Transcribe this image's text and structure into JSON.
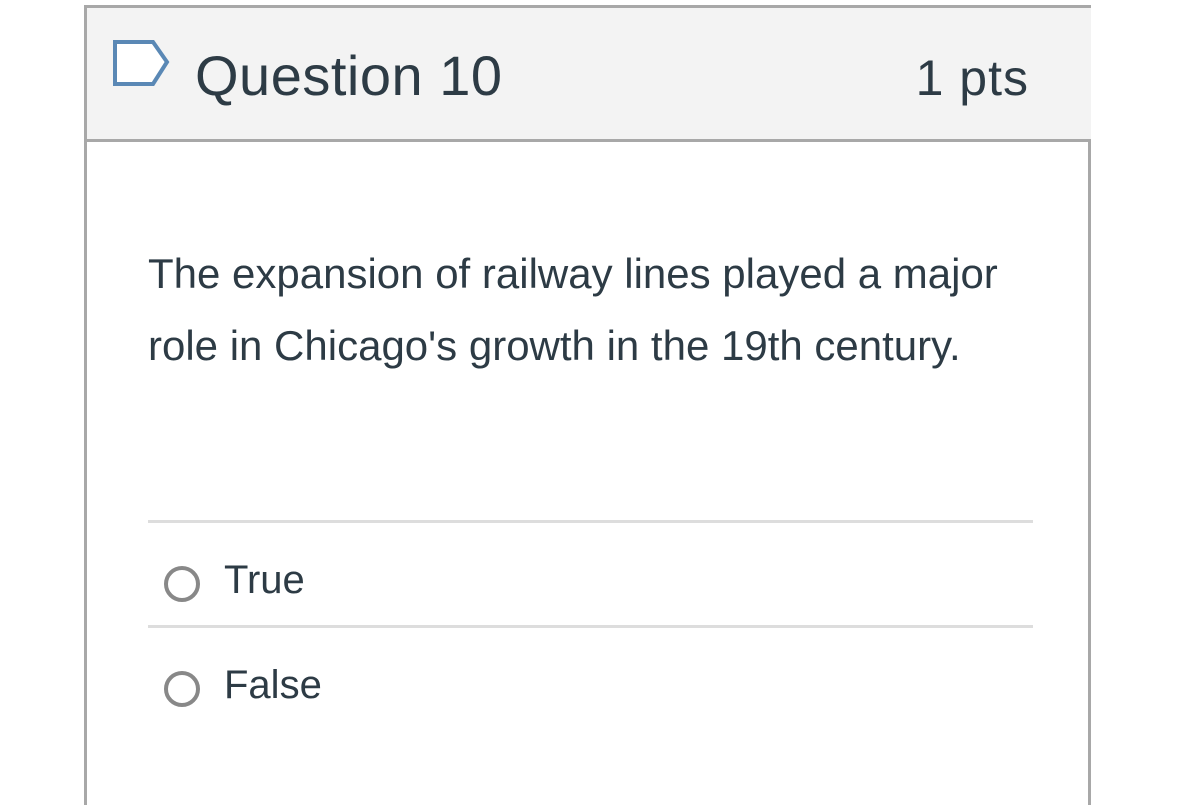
{
  "question": {
    "title": "Question 10",
    "points": "1 pts",
    "text": "The expansion of railway lines played a major role in Chicago's growth in the 19th century.",
    "flag_icon": "bookmark-flag-icon"
  },
  "answers": [
    {
      "label": "True",
      "selected": false
    },
    {
      "label": "False",
      "selected": false
    }
  ],
  "colors": {
    "header_bg": "#f3f3f3",
    "border": "#a8a8a8",
    "text": "#2d3b45",
    "radio": "#888888",
    "flag": "#5a88b5"
  }
}
